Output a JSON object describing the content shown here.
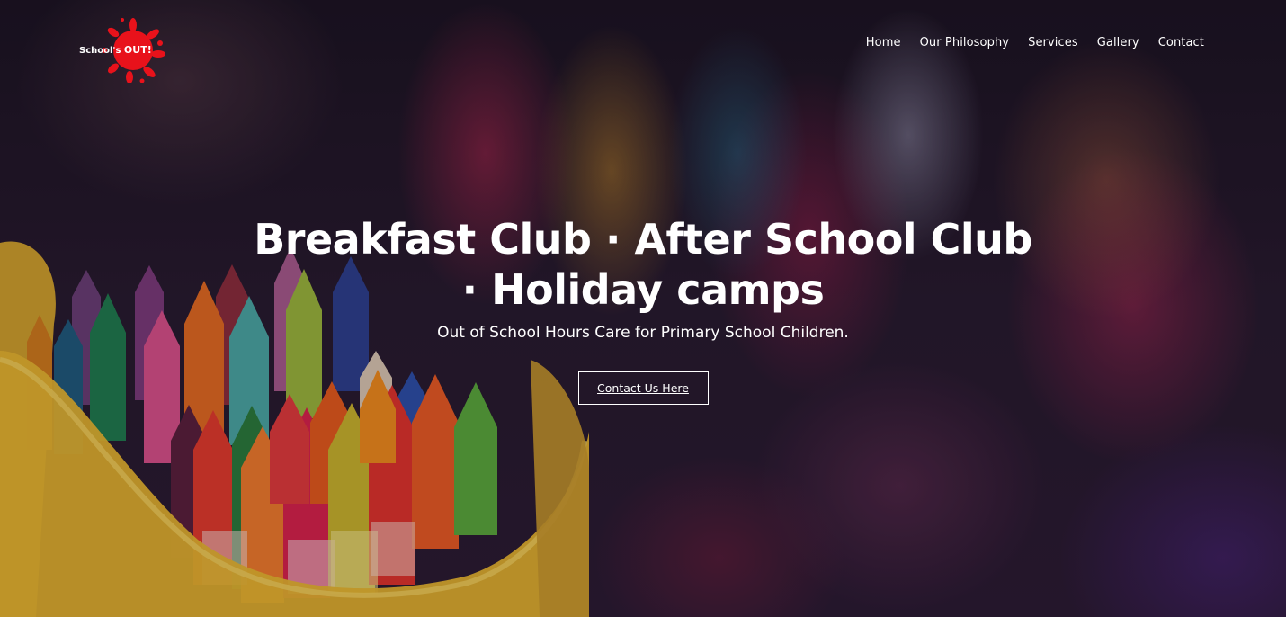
{
  "logo": {
    "text_prefix": "School's ",
    "text_out": "OUT!",
    "accent_color": "#e8121b"
  },
  "nav": {
    "items": [
      {
        "label": "Home"
      },
      {
        "label": "Our Philosophy"
      },
      {
        "label": "Services"
      },
      {
        "label": "Gallery"
      },
      {
        "label": "Contact"
      }
    ]
  },
  "hero": {
    "headline_line1": "Breakfast Club · After School Club",
    "headline_line2": "· Holiday camps",
    "subheading": "Out of School Hours Care for Primary School Children.",
    "cta_label": "Contact Us Here",
    "background_icon": "crayons-photo"
  }
}
